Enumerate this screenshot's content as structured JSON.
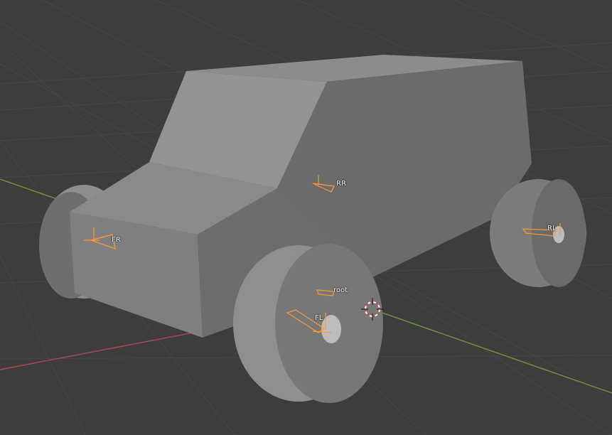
{
  "viewport": {
    "background": "#3d3d3d",
    "grid_color": "#4a4a4a",
    "x_axis_color": "#b04a4a",
    "y_axis_color": "#6f9a3a",
    "bone_color": "#ff9a2e",
    "body_color": "#7a7a7a"
  },
  "scene": {
    "object": "car-mesh",
    "wheels": [
      "front-left-wheel",
      "front-right-wheel",
      "rear-left-wheel",
      "rear-right-wheel"
    ],
    "cursor_icon": "3d-cursor-icon"
  },
  "bones": {
    "fr": "FR",
    "rr": "RR",
    "rl": "RL",
    "root": "root",
    "fl": "FL"
  }
}
